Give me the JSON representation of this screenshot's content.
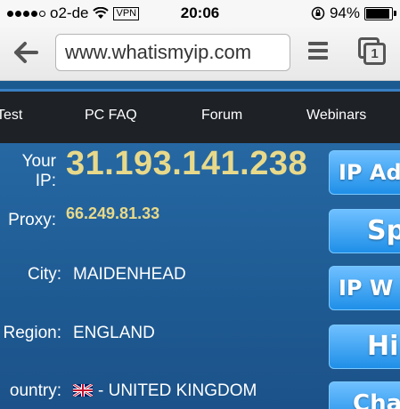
{
  "status_bar": {
    "carrier": "o2-de",
    "vpn": "VPN",
    "time": "20:06",
    "battery": "94%",
    "battery_level": 0.94
  },
  "browser": {
    "url": "www.whatismyip.com",
    "tab_count": "1"
  },
  "nav": {
    "items": [
      "Test",
      "PC FAQ",
      "Forum",
      "Webinars"
    ]
  },
  "ip_info": {
    "ip_label": "Your IP:",
    "ip_value": "31.193.141.238",
    "proxy_label": "Proxy:",
    "proxy_value": "66.249.81.33",
    "city_label": "City:",
    "city_value": "MAIDENHEAD",
    "region_label": "Region:",
    "region_value": "ENGLAND",
    "country_label": "ountry:",
    "country_value": "- UNITED KINGDOM"
  },
  "side_buttons": [
    "IP Ad",
    "Sp",
    "IP W",
    "Hi",
    "Cha"
  ]
}
